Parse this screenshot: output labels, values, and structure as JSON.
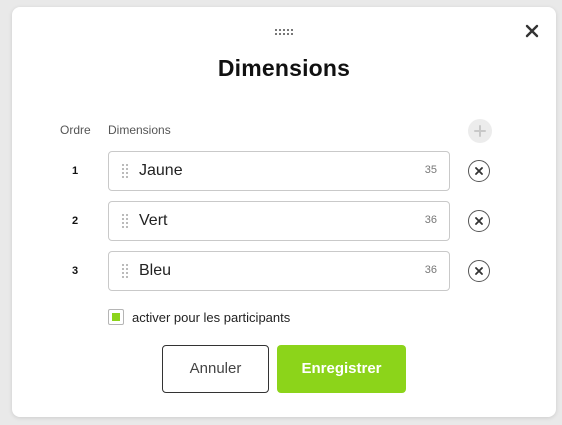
{
  "modal": {
    "title": "Dimensions",
    "close_icon": "close-icon",
    "drag_handle_icon": "drag-handle-icon"
  },
  "columns": {
    "order": "Ordre",
    "dimensions": "Dimensions"
  },
  "add_icon": "plus-icon",
  "rows": [
    {
      "order": "1",
      "value": "Jaune",
      "count": "35"
    },
    {
      "order": "2",
      "value": "Vert",
      "count": "36"
    },
    {
      "order": "3",
      "value": "Bleu",
      "count": "36"
    }
  ],
  "checkbox": {
    "label": "activer pour les participants",
    "checked": true
  },
  "buttons": {
    "cancel": "Annuler",
    "save": "Enregistrer"
  },
  "colors": {
    "accent": "#8cd41a",
    "border": "#c9c9c9",
    "text": "#222222"
  }
}
